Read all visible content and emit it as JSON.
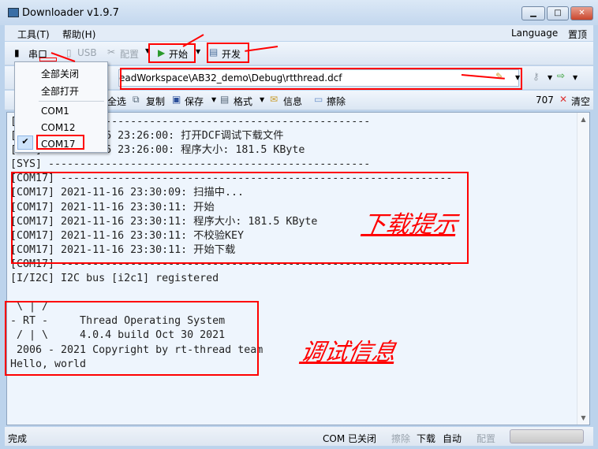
{
  "window": {
    "title": "Downloader v1.9.7",
    "minimize": "▁",
    "maximize": "□",
    "close": "✕"
  },
  "menu": {
    "tools": "工具(T)",
    "help": "帮助(H)",
    "language": "Language",
    "topmost": "置顶"
  },
  "toolbar1": {
    "serial": "串口",
    "usb": "USB",
    "config": "配置",
    "start": "开始",
    "develop": "开发"
  },
  "toolbar2": {
    "path": "eadWorkspace\\AB32_demo\\Debug\\rtthread.dcf"
  },
  "toolbar3": {
    "select_all": "全选",
    "copy": "复制",
    "save": "保存",
    "format": "格式",
    "info": "信息",
    "erase": "擦除",
    "count": "707",
    "clear": "清空"
  },
  "serial_menu": {
    "close_all": "全部关闭",
    "open_all": "全部打开",
    "ports": [
      "COM1",
      "COM12",
      "COM17"
    ],
    "checked": "COM17"
  },
  "terminal": {
    "lines": [
      "[SYS] ---------------------------------------------------",
      "[SYS] 2021-11-16 23:26:00: 打开DCF调试下载文件",
      "[SYS] 2021-11-16 23:26:00: 程序大小: 181.5 KByte",
      "[SYS] ---------------------------------------------------",
      "[COM17] --------------------------------------------------------------",
      "[COM17] 2021-11-16 23:30:09: 扫描中...",
      "[COM17] 2021-11-16 23:30:11: 开始",
      "[COM17] 2021-11-16 23:30:11: 程序大小: 181.5 KByte",
      "[COM17] 2021-11-16 23:30:11: 不校验KEY",
      "[COM17] 2021-11-16 23:30:11: 开始下载",
      "[COM17] --------------------------------------------------------------",
      "[I/I2C] I2C bus [i2c1] registered",
      "",
      " \\ | /",
      "- RT -     Thread Operating System",
      " / | \\     4.0.4 build Oct 30 2021",
      " 2006 - 2021 Copyright by rt-thread team",
      "Hello, world"
    ]
  },
  "annotations": {
    "download_hint": "下载提示",
    "debug_info": "调试信息"
  },
  "status": {
    "state": "完成",
    "com": "COM 已关闭",
    "erase": "擦除",
    "download": "下载",
    "auto": "自动",
    "config": "配置"
  }
}
